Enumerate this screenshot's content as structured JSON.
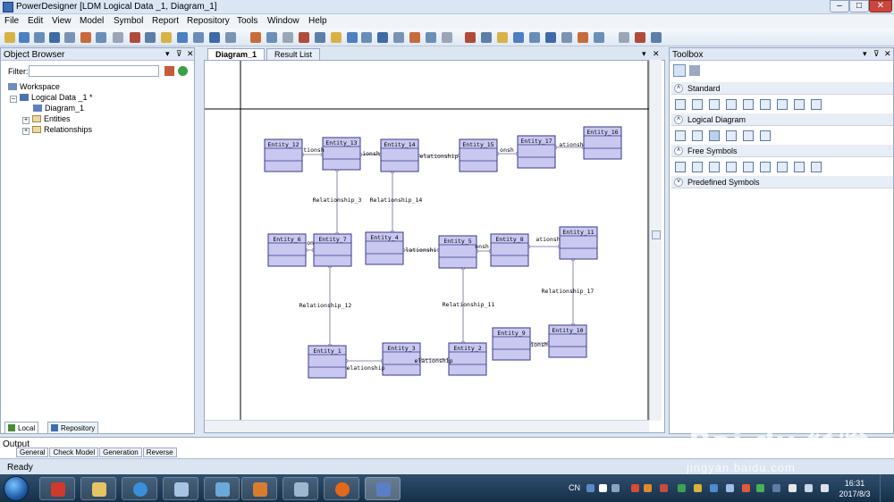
{
  "window": {
    "title": "PowerDesigner [LDM Logical Data _1, Diagram_1]"
  },
  "menu": [
    "File",
    "Edit",
    "View",
    "Model",
    "Symbol",
    "Report",
    "Repository",
    "Tools",
    "Window",
    "Help"
  ],
  "object_browser": {
    "title": "Object Browser",
    "filter_label": "Filter:",
    "filter_value": "",
    "tree": {
      "workspace": "Workspace",
      "model": "Logical Data _1 *",
      "diagram": "Diagram_1",
      "entities": "Entities",
      "relationships": "Relationships"
    },
    "tabs": [
      "Local",
      "Repository"
    ]
  },
  "document_tabs": [
    "Diagram_1",
    "Result List"
  ],
  "diagram": {
    "entities": [
      "Entity_1",
      "Entity_2",
      "Entity_3",
      "Entity_4",
      "Entity_5",
      "Entity_6",
      "Entity_7",
      "Entity_8",
      "Entity_9",
      "Entity_10",
      "Entity_11",
      "Entity_12",
      "Entity_13",
      "Entity_14",
      "Entity_15",
      "Entity_16",
      "Entity_17"
    ],
    "relationship_labels": {
      "r3": "Relationship_3",
      "r14": "Relationship_14",
      "r12": "Relationship_12",
      "r11": "Relationship_11",
      "r17": "Relationship_17",
      "frag_a": "tionsh",
      "frag_b": "ionsh",
      "frag_c": "elationship",
      "frag_d": "onsh",
      "frag_e": "ationsh",
      "frag_f": "on",
      "frag_g": "lationshi",
      "frag_h": "onsh",
      "frag_i": "ationsh",
      "frag_j": "elationship",
      "frag_k": "elationship",
      "frag_l": "ionsh"
    }
  },
  "toolbox": {
    "title": "Toolbox",
    "sections": [
      "Standard",
      "Logical Diagram",
      "Free Symbols",
      "Predefined Symbols"
    ]
  },
  "output": {
    "title": "Output",
    "tabs": [
      "General",
      "Check Model",
      "Generation",
      "Reverse"
    ]
  },
  "status": {
    "text": "Ready"
  },
  "taskbar": {
    "lang": "CN",
    "time": "16:31",
    "date": "2017/8/3"
  },
  "watermark": {
    "brand": "Bai du 经验",
    "url": "jingyan.baidu.com"
  },
  "colors": {
    "entity_fill": "#c8c8f0",
    "entity_border": "#3a3a8c",
    "titlebar": "#dbe6f4"
  }
}
